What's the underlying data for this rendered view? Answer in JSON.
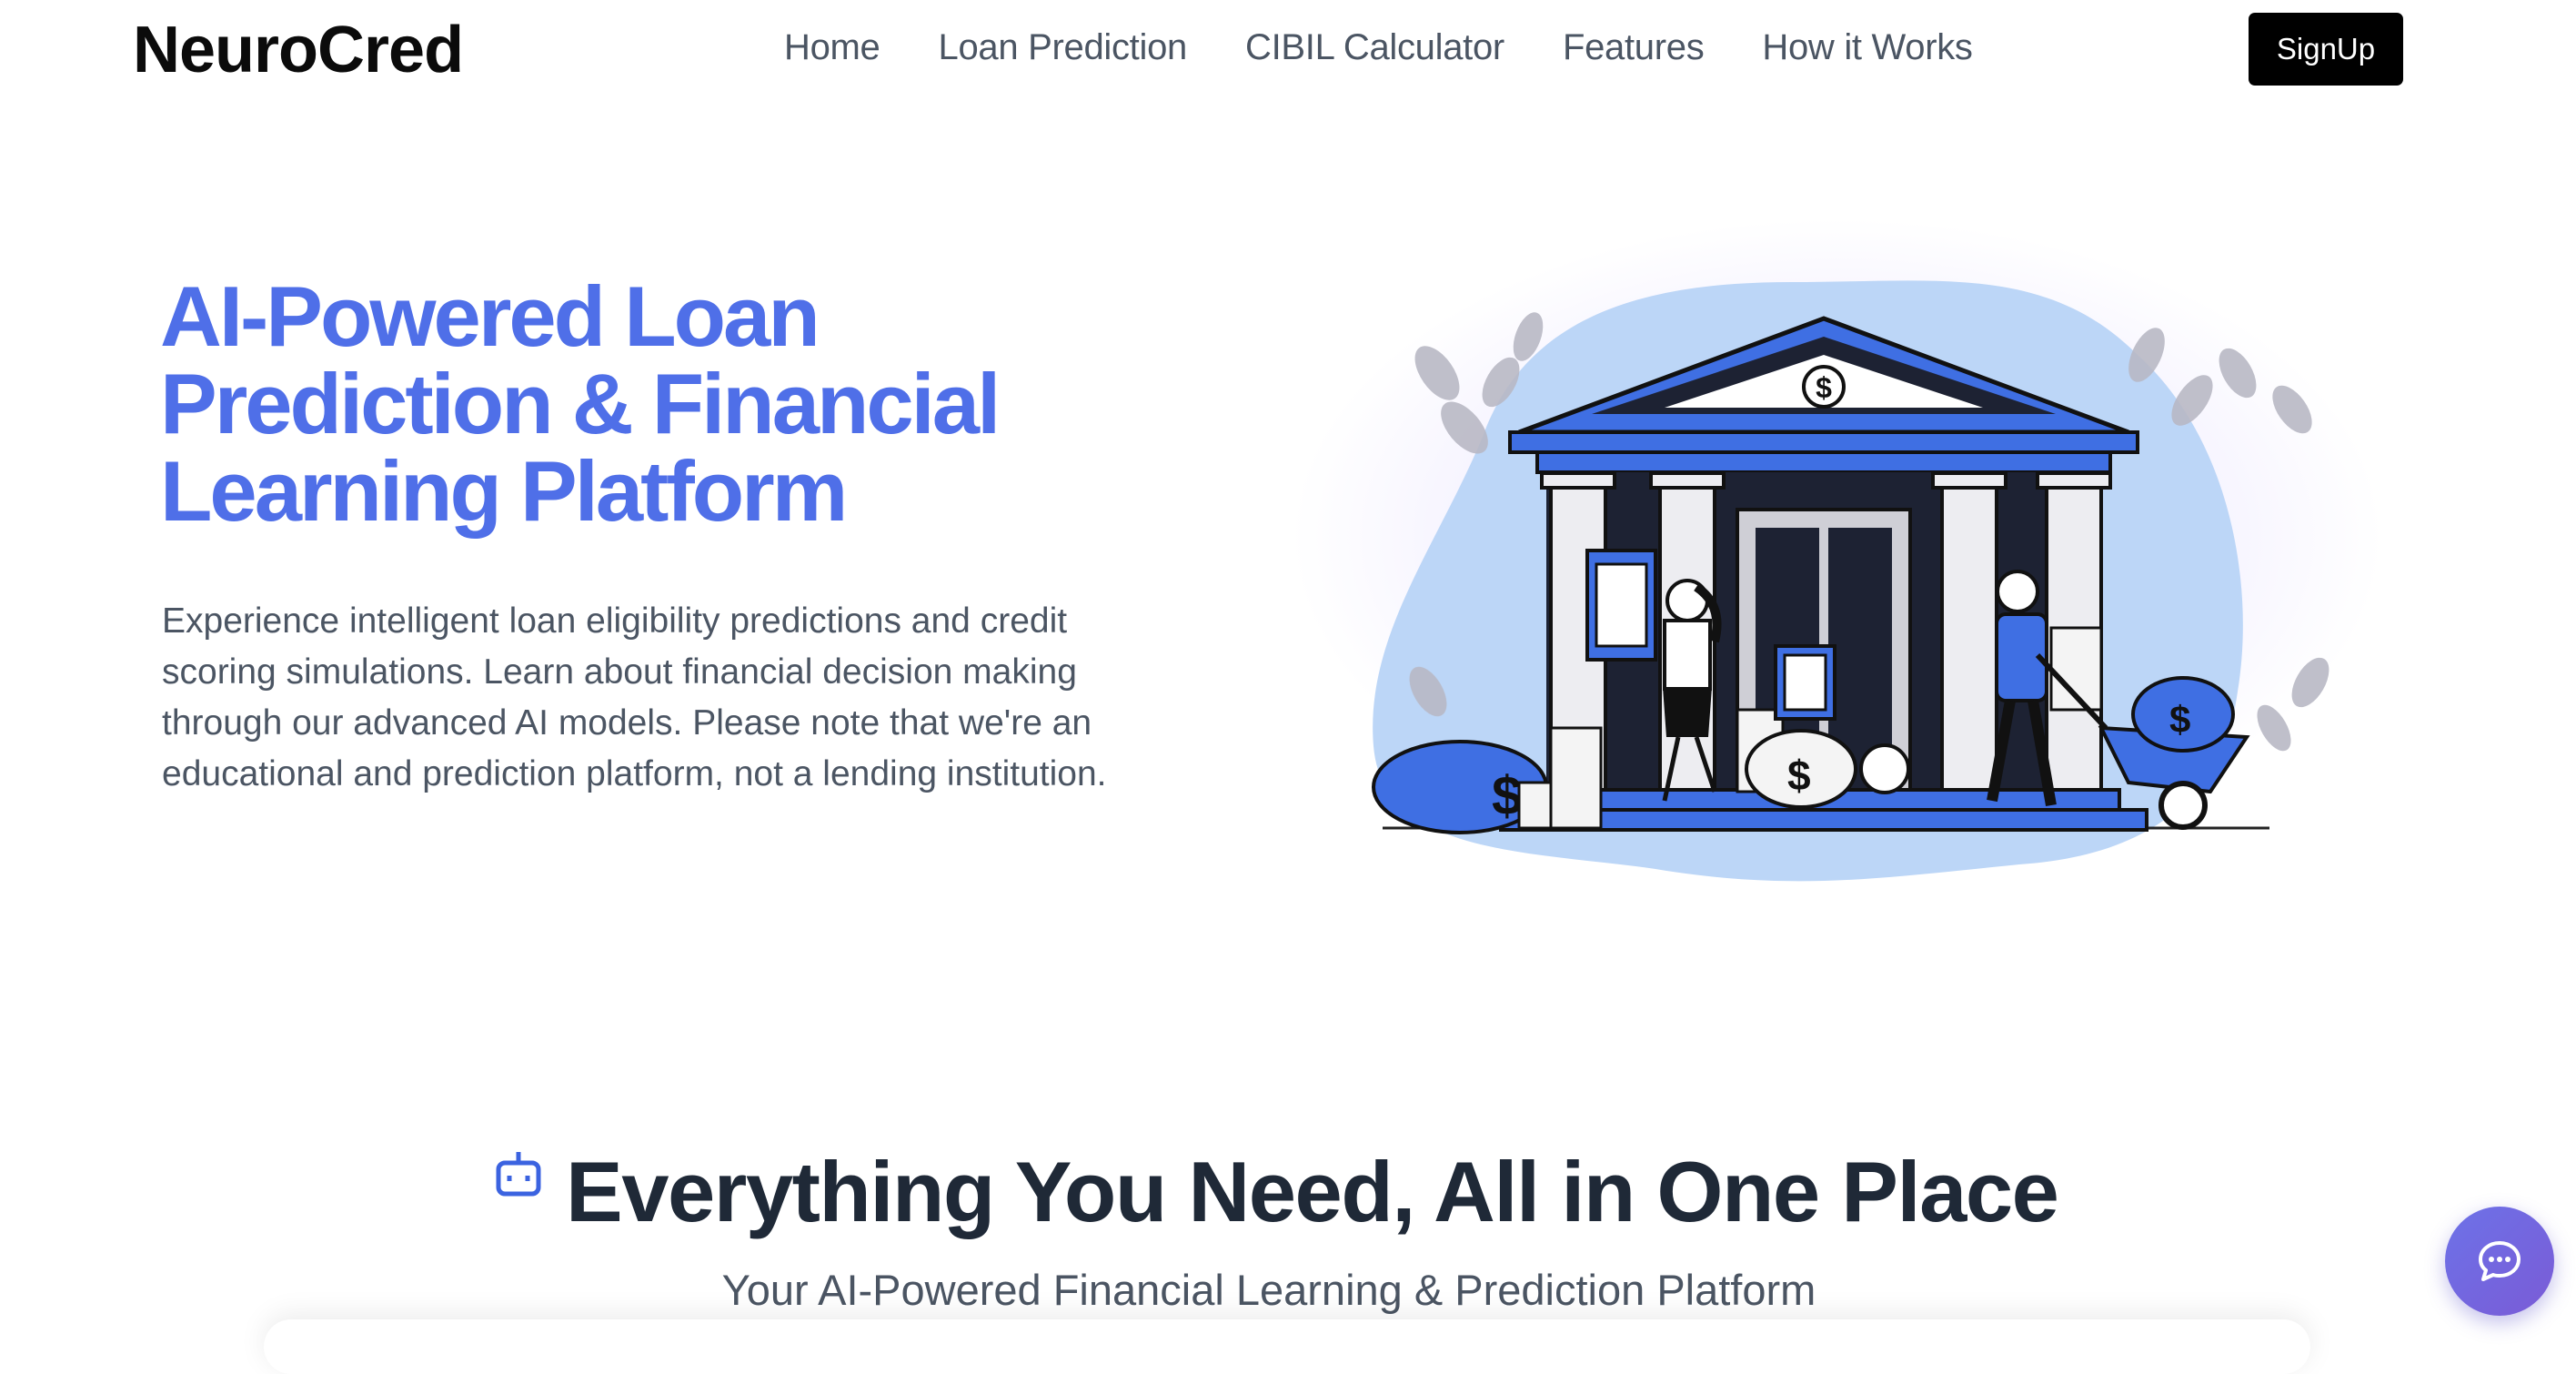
{
  "nav": {
    "brand": "NeuroCred",
    "links": [
      {
        "label": "Home"
      },
      {
        "label": "Loan Prediction"
      },
      {
        "label": "CIBIL Calculator"
      },
      {
        "label": "Features"
      },
      {
        "label": "How it Works"
      }
    ],
    "signup_label": "SignUp"
  },
  "hero": {
    "title_lines": [
      "AI-Powered Loan",
      "Prediction & Financial",
      "Learning Platform"
    ],
    "description_lines": [
      "Experience intelligent loan eligibility predictions and credit",
      "scoring simulations. Learn about financial decision making",
      "through our advanced AI models. Please note that we're an",
      "educational and prediction platform, not a lending institution."
    ],
    "illustration_icon": "bank-illustration-icon",
    "title_color": "#4f6fe8"
  },
  "features": {
    "icon": "robot-icon",
    "title": "Everything You Need, All in One Place",
    "subtitle": "Your AI-Powered Financial Learning & Prediction Platform"
  },
  "chat": {
    "icon": "chat-bubble-icon",
    "accent": "#6d72e8"
  },
  "colors": {
    "primary": "#4f6fe8",
    "illustration_blue": "#3f6fe3",
    "blob": "#bcd6f7"
  }
}
